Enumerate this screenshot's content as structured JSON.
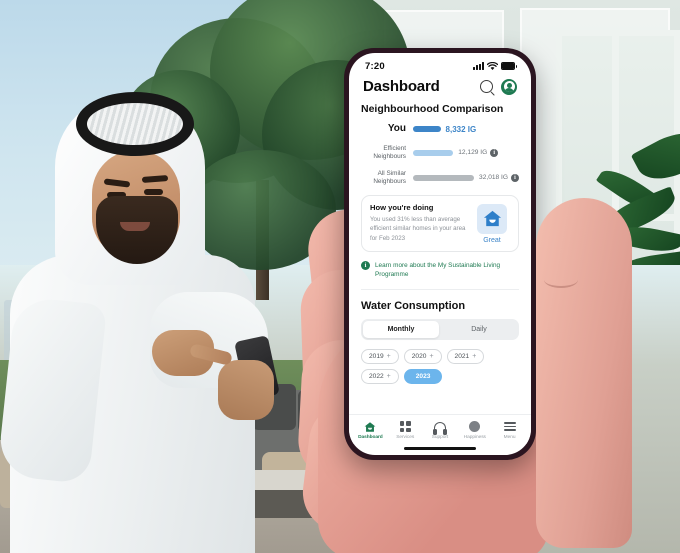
{
  "scene": {
    "description": "Man in Emirati kandura and ghutra using a smartphone outdoors; a large hand holds a phone in the foreground",
    "foreground_hand": "hand-holding-phone"
  },
  "phone": {
    "status_bar": {
      "time": "7:20",
      "icons": [
        "cellular-signal-icon",
        "wifi-icon",
        "battery-icon"
      ]
    },
    "header": {
      "title": "Dashboard",
      "search_icon": "search-icon",
      "avatar_icon": "avatar-icon"
    },
    "neighbourhood": {
      "title": "Neighbourhood Comparison",
      "rows": [
        {
          "label": "You",
          "value": "8,332 IG",
          "bar_pct": 26,
          "color": "#3d85c8",
          "info": false
        },
        {
          "label": "Efficient\nNeighbours",
          "value": "12,129 IG",
          "bar_pct": 38,
          "color": "#a8cdec",
          "info": true
        },
        {
          "label": "All Similar\nNeighbours",
          "value": "32,018 IG",
          "bar_pct": 100,
          "color": "#b4b9bd",
          "info": true
        }
      ],
      "info_glyph": "i"
    },
    "doing_card": {
      "title": "How you're doing",
      "body": "You used 31%  less than average efficient similar homes in your area for Feb 2023",
      "badge_icon": "house-icon",
      "badge_label": "Great",
      "badge_bg": "#dce9f7",
      "badge_color": "#3d85c8"
    },
    "learn_more": {
      "icon": "info-icon",
      "icon_glyph": "i",
      "text": "Learn more about the My Sustainable Living Programme",
      "color": "#1f7a52"
    },
    "water": {
      "title": "Water Consumption",
      "tabs": [
        {
          "label": "Monthly",
          "active": true
        },
        {
          "label": "Daily",
          "active": false
        }
      ],
      "year_chips": [
        {
          "label": "2019",
          "expand": "+",
          "selected": false
        },
        {
          "label": "2020",
          "expand": "+",
          "selected": false
        },
        {
          "label": "2021",
          "expand": "+",
          "selected": false
        },
        {
          "label": "2022",
          "expand": "+",
          "selected": false
        },
        {
          "label": "2023",
          "expand": "",
          "selected": true
        }
      ],
      "selected_chip_color": "#6cb5ec"
    },
    "bottom_nav": [
      {
        "label": "Dashboard",
        "icon": "home-icon",
        "active": true
      },
      {
        "label": "Services",
        "icon": "grid-icon",
        "active": false
      },
      {
        "label": "Support",
        "icon": "headset-icon",
        "active": false
      },
      {
        "label": "Happiness",
        "icon": "smiley-icon",
        "active": false
      },
      {
        "label": "Menu",
        "icon": "hamburger-icon",
        "active": false
      }
    ]
  }
}
